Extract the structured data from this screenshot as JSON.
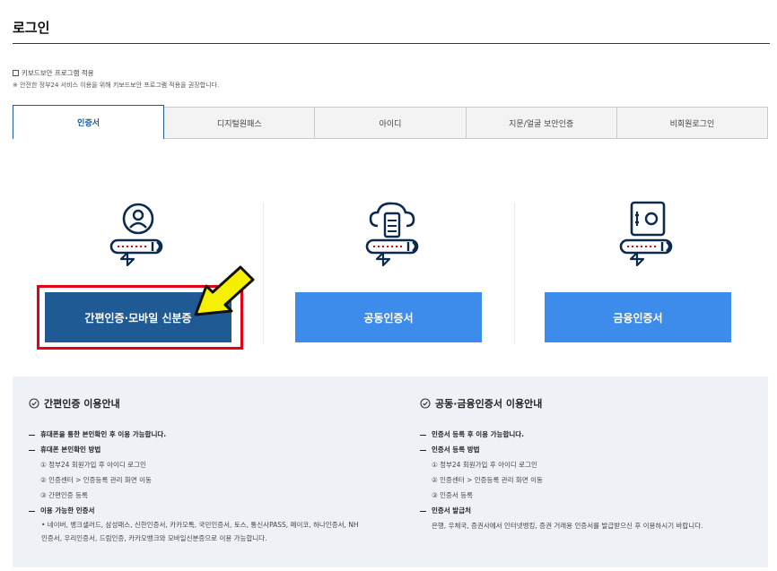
{
  "page": {
    "title": "로그인"
  },
  "keyboard": {
    "checkbox_label": "키보드보안 프로그램 적용",
    "notice": "※ 안전한 정부24 서비스 이용을 위해 키보드보안 프로그램 적용을 권장합니다."
  },
  "tabs": [
    {
      "label": "인증서",
      "active": true
    },
    {
      "label": "디지털원패스",
      "active": false
    },
    {
      "label": "아이디",
      "active": false
    },
    {
      "label": "지문/얼굴 보안인증",
      "active": false
    },
    {
      "label": "비회원로그인",
      "active": false
    }
  ],
  "methods": [
    {
      "label": "간편인증·모바일 신분증",
      "icon": "person-key-icon",
      "highlighted": true
    },
    {
      "label": "공동인증서",
      "icon": "cloud-server-key-icon",
      "highlighted": false
    },
    {
      "label": "금융인증서",
      "icon": "safe-key-icon",
      "highlighted": false
    }
  ],
  "colors": {
    "accent": "#205a95",
    "button": "#3d8bea",
    "highlight": "#e60012",
    "arrow": "#f5f000",
    "panel": "#eef2f6"
  },
  "guide": {
    "simple": {
      "title": "간편인증 이용안내",
      "item1": "휴대폰을 통한 본인확인 후 이용 가능합니다.",
      "item2": "휴대폰 본인확인 방법",
      "step1": "① 정부24 회원가입 후 아이디 로그인",
      "step2": "② 인증센터 > 인증등록 관리 화면 이동",
      "step3": "③ 간편인증 등록",
      "item3": "이용 가능한 인증서",
      "available": "• 네이버, 뱅크샐러드, 삼성패스, 신한인증서, 카카오톡, 국민인증서, 토스, 통신사PASS, 페이코, 하나인증서, NH인증서, 우리인증서, 드림인증, 카카오뱅크와 모바일신분증으로 이용 가능합니다."
    },
    "joint": {
      "title": "공동·금융인증서 이용안내",
      "item1": "인증서 등록 후 이용 가능합니다.",
      "item2": "인증서 등록 방법",
      "step1": "① 정부24 회원가입 후 아이디 로그인",
      "step2": "② 인증센터 > 인증등록 관리 화면 이동",
      "step3": "③ 인증서 등록",
      "item3": "인증서 발급처",
      "issuers": "은행, 우체국, 증권사에서 인터넷뱅킹, 증권 거래용 인증서를 발급받으신 후 이용하시기 바랍니다."
    }
  }
}
